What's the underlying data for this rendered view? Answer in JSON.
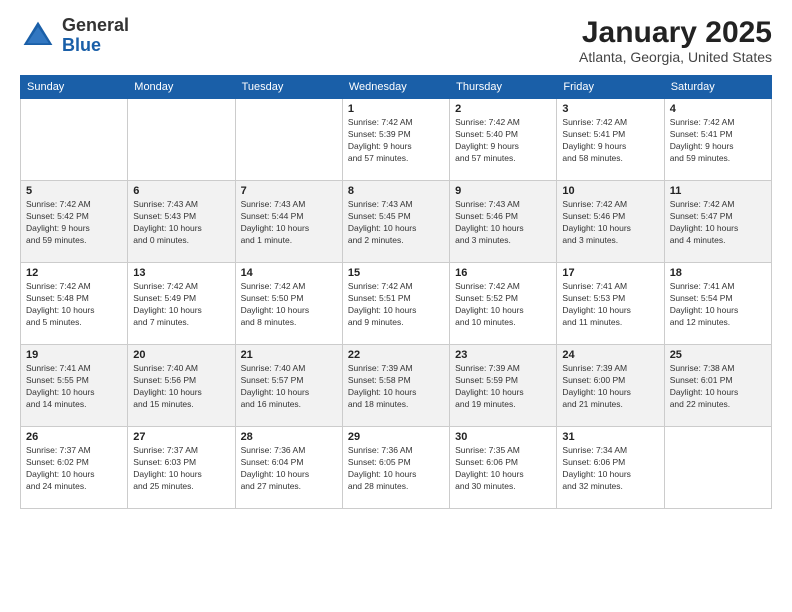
{
  "header": {
    "logo_general": "General",
    "logo_blue": "Blue",
    "month_title": "January 2025",
    "location": "Atlanta, Georgia, United States"
  },
  "days_of_week": [
    "Sunday",
    "Monday",
    "Tuesday",
    "Wednesday",
    "Thursday",
    "Friday",
    "Saturday"
  ],
  "weeks": [
    [
      {
        "day": "",
        "info": ""
      },
      {
        "day": "",
        "info": ""
      },
      {
        "day": "",
        "info": ""
      },
      {
        "day": "1",
        "info": "Sunrise: 7:42 AM\nSunset: 5:39 PM\nDaylight: 9 hours\nand 57 minutes."
      },
      {
        "day": "2",
        "info": "Sunrise: 7:42 AM\nSunset: 5:40 PM\nDaylight: 9 hours\nand 57 minutes."
      },
      {
        "day": "3",
        "info": "Sunrise: 7:42 AM\nSunset: 5:41 PM\nDaylight: 9 hours\nand 58 minutes."
      },
      {
        "day": "4",
        "info": "Sunrise: 7:42 AM\nSunset: 5:41 PM\nDaylight: 9 hours\nand 59 minutes."
      }
    ],
    [
      {
        "day": "5",
        "info": "Sunrise: 7:42 AM\nSunset: 5:42 PM\nDaylight: 9 hours\nand 59 minutes."
      },
      {
        "day": "6",
        "info": "Sunrise: 7:43 AM\nSunset: 5:43 PM\nDaylight: 10 hours\nand 0 minutes."
      },
      {
        "day": "7",
        "info": "Sunrise: 7:43 AM\nSunset: 5:44 PM\nDaylight: 10 hours\nand 1 minute."
      },
      {
        "day": "8",
        "info": "Sunrise: 7:43 AM\nSunset: 5:45 PM\nDaylight: 10 hours\nand 2 minutes."
      },
      {
        "day": "9",
        "info": "Sunrise: 7:43 AM\nSunset: 5:46 PM\nDaylight: 10 hours\nand 3 minutes."
      },
      {
        "day": "10",
        "info": "Sunrise: 7:42 AM\nSunset: 5:46 PM\nDaylight: 10 hours\nand 3 minutes."
      },
      {
        "day": "11",
        "info": "Sunrise: 7:42 AM\nSunset: 5:47 PM\nDaylight: 10 hours\nand 4 minutes."
      }
    ],
    [
      {
        "day": "12",
        "info": "Sunrise: 7:42 AM\nSunset: 5:48 PM\nDaylight: 10 hours\nand 5 minutes."
      },
      {
        "day": "13",
        "info": "Sunrise: 7:42 AM\nSunset: 5:49 PM\nDaylight: 10 hours\nand 7 minutes."
      },
      {
        "day": "14",
        "info": "Sunrise: 7:42 AM\nSunset: 5:50 PM\nDaylight: 10 hours\nand 8 minutes."
      },
      {
        "day": "15",
        "info": "Sunrise: 7:42 AM\nSunset: 5:51 PM\nDaylight: 10 hours\nand 9 minutes."
      },
      {
        "day": "16",
        "info": "Sunrise: 7:42 AM\nSunset: 5:52 PM\nDaylight: 10 hours\nand 10 minutes."
      },
      {
        "day": "17",
        "info": "Sunrise: 7:41 AM\nSunset: 5:53 PM\nDaylight: 10 hours\nand 11 minutes."
      },
      {
        "day": "18",
        "info": "Sunrise: 7:41 AM\nSunset: 5:54 PM\nDaylight: 10 hours\nand 12 minutes."
      }
    ],
    [
      {
        "day": "19",
        "info": "Sunrise: 7:41 AM\nSunset: 5:55 PM\nDaylight: 10 hours\nand 14 minutes."
      },
      {
        "day": "20",
        "info": "Sunrise: 7:40 AM\nSunset: 5:56 PM\nDaylight: 10 hours\nand 15 minutes."
      },
      {
        "day": "21",
        "info": "Sunrise: 7:40 AM\nSunset: 5:57 PM\nDaylight: 10 hours\nand 16 minutes."
      },
      {
        "day": "22",
        "info": "Sunrise: 7:39 AM\nSunset: 5:58 PM\nDaylight: 10 hours\nand 18 minutes."
      },
      {
        "day": "23",
        "info": "Sunrise: 7:39 AM\nSunset: 5:59 PM\nDaylight: 10 hours\nand 19 minutes."
      },
      {
        "day": "24",
        "info": "Sunrise: 7:39 AM\nSunset: 6:00 PM\nDaylight: 10 hours\nand 21 minutes."
      },
      {
        "day": "25",
        "info": "Sunrise: 7:38 AM\nSunset: 6:01 PM\nDaylight: 10 hours\nand 22 minutes."
      }
    ],
    [
      {
        "day": "26",
        "info": "Sunrise: 7:37 AM\nSunset: 6:02 PM\nDaylight: 10 hours\nand 24 minutes."
      },
      {
        "day": "27",
        "info": "Sunrise: 7:37 AM\nSunset: 6:03 PM\nDaylight: 10 hours\nand 25 minutes."
      },
      {
        "day": "28",
        "info": "Sunrise: 7:36 AM\nSunset: 6:04 PM\nDaylight: 10 hours\nand 27 minutes."
      },
      {
        "day": "29",
        "info": "Sunrise: 7:36 AM\nSunset: 6:05 PM\nDaylight: 10 hours\nand 28 minutes."
      },
      {
        "day": "30",
        "info": "Sunrise: 7:35 AM\nSunset: 6:06 PM\nDaylight: 10 hours\nand 30 minutes."
      },
      {
        "day": "31",
        "info": "Sunrise: 7:34 AM\nSunset: 6:06 PM\nDaylight: 10 hours\nand 32 minutes."
      },
      {
        "day": "",
        "info": ""
      }
    ]
  ]
}
